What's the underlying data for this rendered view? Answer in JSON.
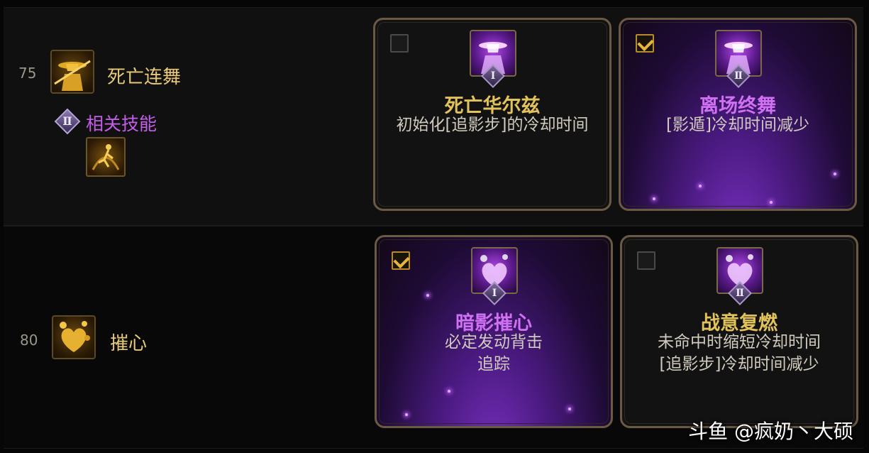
{
  "rows": [
    {
      "level": "75",
      "skill_name": "死亡连舞",
      "related": {
        "badge": "Ⅱ",
        "label": "相关技能"
      },
      "cards": [
        {
          "selected": false,
          "badge": "Ⅰ",
          "title": "死亡华尔兹",
          "desc": [
            "初始化[追影步]的冷却时间"
          ]
        },
        {
          "selected": true,
          "badge": "Ⅱ",
          "title": "离场终舞",
          "desc": [
            "[影遁]冷却时间减少"
          ]
        }
      ]
    },
    {
      "level": "80",
      "skill_name": "摧心",
      "cards": [
        {
          "selected": true,
          "badge": "Ⅰ",
          "title": "暗影摧心",
          "desc": [
            "必定发动背击",
            "追踪"
          ]
        },
        {
          "selected": false,
          "badge": "Ⅱ",
          "title": "战意复燃",
          "desc": [
            "未命中时缩短冷却时间",
            "[追影步]冷却时间减少"
          ]
        }
      ]
    }
  ],
  "watermark": "斗鱼 @疯奶丶大硕",
  "colors": {
    "gold_text": "#e8c978",
    "purple_text": "#c45ee8",
    "card_border": "#6a5a44",
    "checkbox_check": "#e7b53a"
  }
}
